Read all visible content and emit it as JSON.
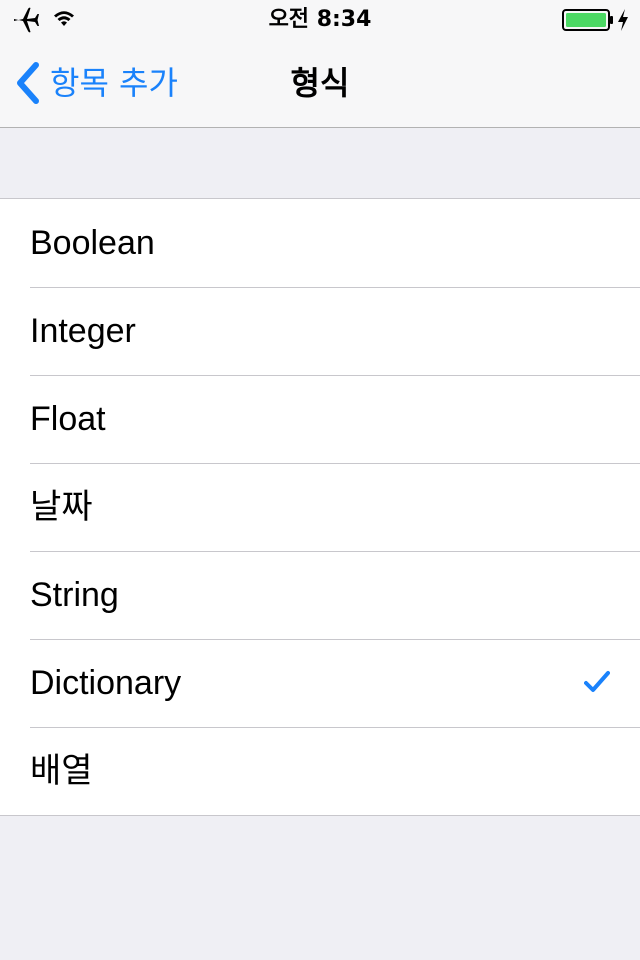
{
  "status_bar": {
    "time": "오전 8:34",
    "battery_color": "#4cd964",
    "icons": [
      "airplane-icon",
      "wifi-icon",
      "battery-icon",
      "charging-bolt-icon"
    ]
  },
  "nav": {
    "back_label": "항목 추가",
    "title": "형식",
    "accent_color": "#1a82fb"
  },
  "types": [
    {
      "label": "Boolean",
      "selected": false
    },
    {
      "label": "Integer",
      "selected": false
    },
    {
      "label": "Float",
      "selected": false
    },
    {
      "label": "날짜",
      "selected": false
    },
    {
      "label": "String",
      "selected": false
    },
    {
      "label": "Dictionary",
      "selected": true
    },
    {
      "label": "배열",
      "selected": false
    }
  ]
}
